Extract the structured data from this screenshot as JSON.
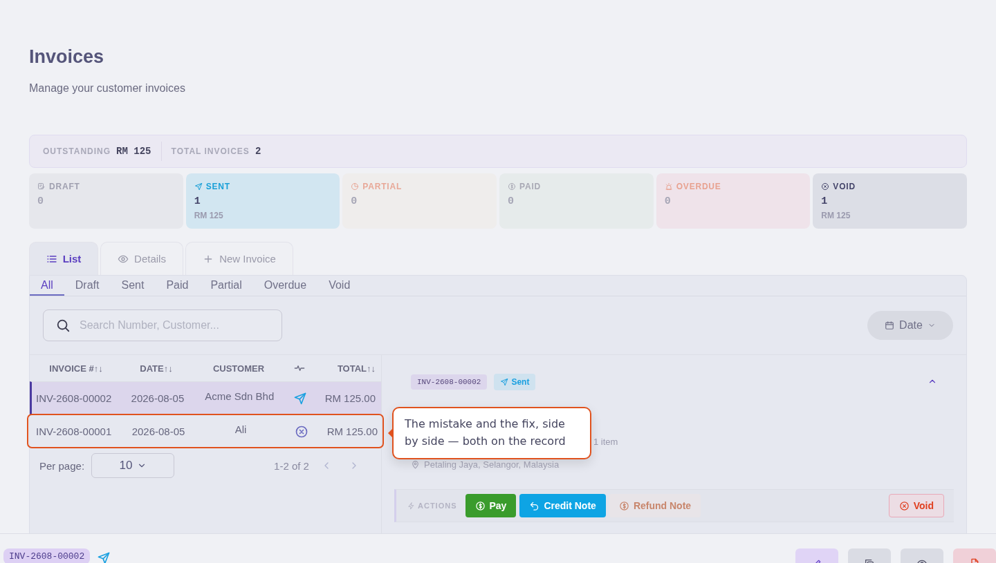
{
  "header": {
    "title": "Invoices",
    "subtitle": "Manage your customer invoices"
  },
  "summary": [
    {
      "label": "OUTSTANDING",
      "value": "RM 125"
    },
    {
      "label": "TOTAL INVOICES",
      "value": "2"
    }
  ],
  "status_cards": [
    {
      "kind": "draft",
      "label": "DRAFT",
      "count": "0"
    },
    {
      "kind": "sent",
      "label": "SENT",
      "count": "1",
      "amount": "RM 125"
    },
    {
      "kind": "partial",
      "label": "PARTIAL",
      "count": "0"
    },
    {
      "kind": "paid",
      "label": "PAID",
      "count": "0"
    },
    {
      "kind": "overdue",
      "label": "OVERDUE",
      "count": "0"
    },
    {
      "kind": "void",
      "label": "VOID",
      "count": "1",
      "amount": "RM 125"
    }
  ],
  "view_tabs": [
    {
      "kind": "list",
      "label": "List",
      "selected": true
    },
    {
      "kind": "details",
      "label": "Details",
      "selected": false
    },
    {
      "kind": "new",
      "label": "New Invoice",
      "selected": false
    }
  ],
  "filter_tabs": [
    {
      "label": "All",
      "selected": true
    },
    {
      "label": "Draft",
      "selected": false
    },
    {
      "label": "Sent",
      "selected": false
    },
    {
      "label": "Paid",
      "selected": false
    },
    {
      "label": "Partial",
      "selected": false
    },
    {
      "label": "Overdue",
      "selected": false
    },
    {
      "label": "Void",
      "selected": false
    }
  ],
  "search": {
    "placeholder": "Search Number, Customer..."
  },
  "date_button": "Date",
  "table": {
    "columns": [
      "INVOICE #↑↓",
      "DATE↑↓",
      "CUSTOMER",
      "TOTAL↑↓"
    ],
    "rows": [
      {
        "number": "INV-2608-00002",
        "date": "2026-08-05",
        "customer": "Acme Sdn Bhd",
        "kind": "sent",
        "total": "RM 125.00",
        "selected": true,
        "highlighted": false
      },
      {
        "number": "INV-2608-00001",
        "date": "2026-08-05",
        "customer": "Ali",
        "kind": "void",
        "total": "RM 125.00",
        "selected": false,
        "highlighted": true
      }
    ]
  },
  "pagination": {
    "per_page_label": "Per page:",
    "per_page": "10",
    "range": "1-2 of 2"
  },
  "detail": {
    "number": "INV-2608-00002",
    "badge": {
      "kind": "sent",
      "label": "Sent"
    },
    "items": "1 item",
    "address": "Petaling Jaya, Selangor, Malaysia",
    "actions_label": "ACTIONS",
    "actions": [
      {
        "kind": "pay",
        "label": "Pay",
        "disabled": false
      },
      {
        "kind": "credit",
        "label": "Credit Note",
        "disabled": false
      },
      {
        "kind": "refund",
        "label": "Refund Note",
        "disabled": true
      },
      {
        "kind": "void",
        "label": "Void",
        "disabled": false
      }
    ]
  },
  "callout": {
    "text": "The mistake and the fix, side by side — both on the record"
  },
  "bottom_bar": {
    "number": "INV-2608-00002",
    "status_icon": {
      "kind": "sent"
    },
    "buttons": [
      {
        "kind": "edit"
      },
      {
        "kind": "copy"
      },
      {
        "kind": "view"
      },
      {
        "kind": "pdf"
      }
    ]
  }
}
